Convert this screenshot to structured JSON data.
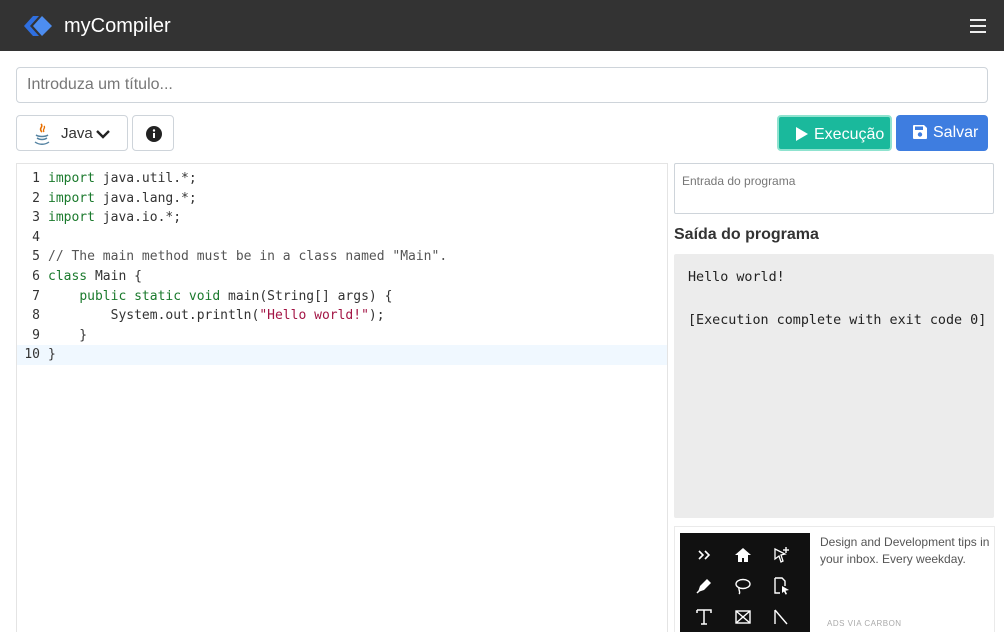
{
  "app": {
    "name": "myCompiler"
  },
  "colors": {
    "navbar": "#333333",
    "run": "#1ab99c",
    "save": "#3e7de0",
    "output_bg": "#ececec",
    "logo": "#3d7be8"
  },
  "title_input": {
    "value": "",
    "placeholder": "Introduza um título..."
  },
  "toolbar": {
    "language_label": "Java",
    "run_label": "Execução",
    "save_label": "Salvar"
  },
  "editor": {
    "language": "java",
    "active_line": 10,
    "lines": [
      {
        "num": "1",
        "text": "import java.util.*;"
      },
      {
        "num": "2",
        "text": "import java.lang.*;"
      },
      {
        "num": "3",
        "text": "import java.io.*;"
      },
      {
        "num": "4",
        "text": ""
      },
      {
        "num": "5",
        "text": "// The main method must be in a class named \"Main\"."
      },
      {
        "num": "6",
        "text": "class Main {"
      },
      {
        "num": "7",
        "text": "    public static void main(String[] args) {"
      },
      {
        "num": "8",
        "text": "        System.out.println(\"Hello world!\");"
      },
      {
        "num": "9",
        "text": "    }"
      },
      {
        "num": "10",
        "text": "}"
      }
    ]
  },
  "stdin": {
    "value": "",
    "placeholder": "Entrada do programa"
  },
  "output": {
    "title": "Saída do programa",
    "lines": [
      "Hello world!",
      "",
      "[Execution complete with exit code 0]"
    ]
  },
  "ad": {
    "text": "Design and Development tips in your inbox. Every weekday.",
    "via": "ADS VIA CARBON",
    "icons": [
      "chevrons-right-icon",
      "home-icon",
      "cursor-plus-icon",
      "pen-icon",
      "lasso-icon",
      "file-cursor-icon",
      "text-tool-icon",
      "frame-icon",
      "angle-icon"
    ]
  }
}
